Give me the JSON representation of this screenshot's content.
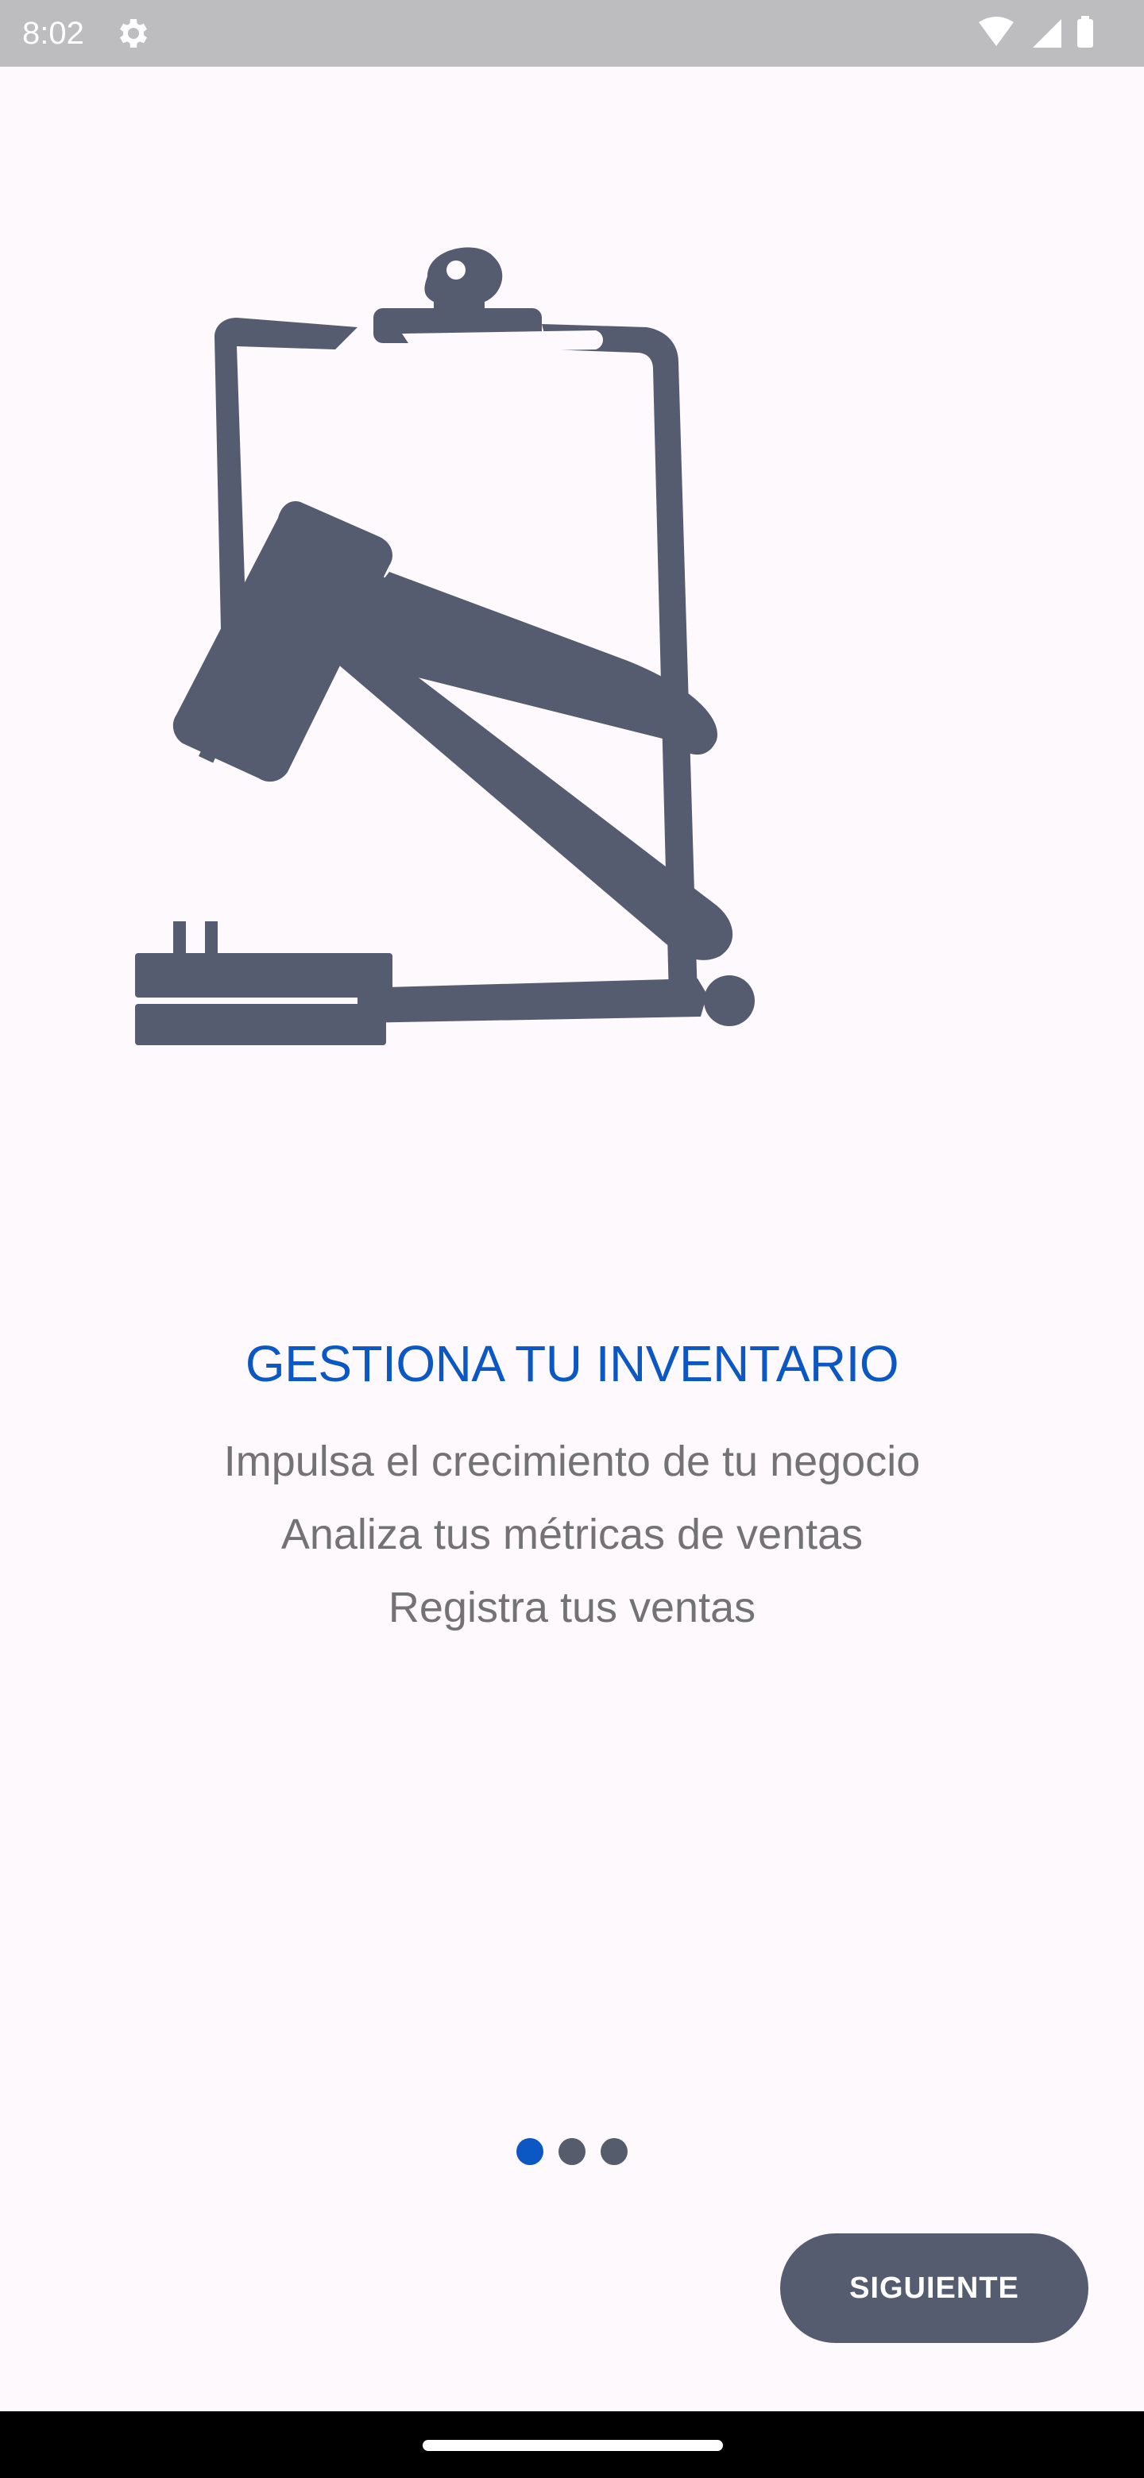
{
  "status_bar": {
    "time": "8:02",
    "icons": [
      "settings-gear-icon",
      "wifi-icon",
      "cell-signal-icon",
      "battery-icon"
    ]
  },
  "illustration": {
    "icon": "clipboard-gavel-icon",
    "color": "#555C6F"
  },
  "onboarding": {
    "title": "GESTIONA TU INVENTARIO",
    "lines": [
      "Impulsa el crecimiento de tu negocio",
      "Analiza tus métricas de ventas",
      "Registra tus ventas"
    ]
  },
  "pager": {
    "current_page": 1,
    "total_pages": 3
  },
  "actions": {
    "next_label": "SIGUIENTE"
  },
  "colors": {
    "accent": "#0B57C4",
    "button": "#555C6F",
    "background": "#FDF9FC",
    "text_secondary": "#737375"
  }
}
